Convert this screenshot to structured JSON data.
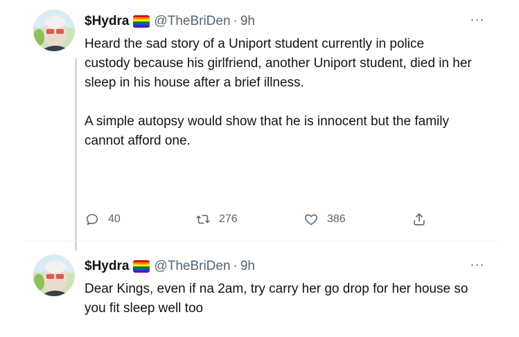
{
  "tweets": [
    {
      "name": "$Hydra",
      "handle": "@TheBriDen",
      "separator": "·",
      "time": "9h",
      "more_label": "···",
      "paragraphs": [
        "Heard the sad story of a Uniport student currently  in police custody because his girlfriend, another Uniport student, died in her sleep in his house after a brief illness.",
        "A simple autopsy would show that he is innocent but the family cannot afford one."
      ],
      "replies": "40",
      "retweets": "276",
      "likes": "386"
    },
    {
      "name": "$Hydra",
      "handle": "@TheBriDen",
      "separator": "·",
      "time": "9h",
      "more_label": "···",
      "paragraphs": [
        "Dear Kings, even if na 2am, try carry her go drop for her house so you fit sleep well too"
      ]
    }
  ],
  "icons": {
    "reply": "reply-icon",
    "retweet": "retweet-icon",
    "like": "like-icon",
    "share": "share-icon",
    "flag": "rainbow-flag-icon"
  },
  "colors": {
    "text": "#0f1419",
    "secondary": "#536471",
    "thread_line": "#cfd9de"
  }
}
